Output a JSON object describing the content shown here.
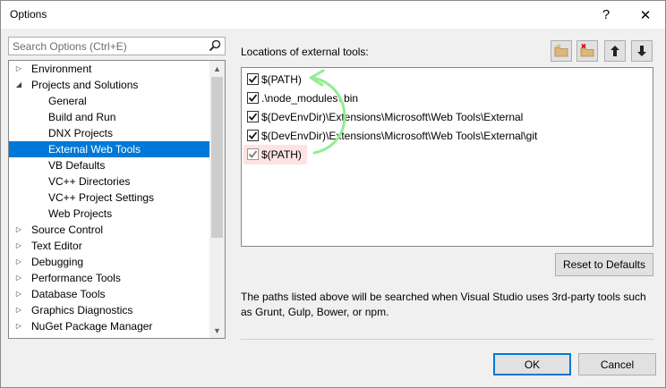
{
  "window": {
    "title": "Options",
    "help_glyph": "?",
    "close_glyph": "✕"
  },
  "search": {
    "placeholder": "Search Options (Ctrl+E)"
  },
  "tree": {
    "items": [
      {
        "label": "Environment",
        "level": 0,
        "arrow": "▷"
      },
      {
        "label": "Projects and Solutions",
        "level": 0,
        "arrow": "◢"
      },
      {
        "label": "General",
        "level": 1,
        "arrow": ""
      },
      {
        "label": "Build and Run",
        "level": 1,
        "arrow": ""
      },
      {
        "label": "DNX Projects",
        "level": 1,
        "arrow": ""
      },
      {
        "label": "External Web Tools",
        "level": 1,
        "arrow": "",
        "selected": true
      },
      {
        "label": "VB Defaults",
        "level": 1,
        "arrow": ""
      },
      {
        "label": "VC++ Directories",
        "level": 1,
        "arrow": ""
      },
      {
        "label": "VC++ Project Settings",
        "level": 1,
        "arrow": ""
      },
      {
        "label": "Web Projects",
        "level": 1,
        "arrow": ""
      },
      {
        "label": "Source Control",
        "level": 0,
        "arrow": "▷"
      },
      {
        "label": "Text Editor",
        "level": 0,
        "arrow": "▷"
      },
      {
        "label": "Debugging",
        "level": 0,
        "arrow": "▷"
      },
      {
        "label": "Performance Tools",
        "level": 0,
        "arrow": "▷"
      },
      {
        "label": "Database Tools",
        "level": 0,
        "arrow": "▷"
      },
      {
        "label": "Graphics Diagnostics",
        "level": 0,
        "arrow": "▷"
      },
      {
        "label": "NuGet Package Manager",
        "level": 0,
        "arrow": "▷"
      }
    ],
    "scroll_up_glyph": "▲",
    "scroll_down_glyph": "▼"
  },
  "locations": {
    "label": "Locations of external tools:",
    "toolbar": [
      {
        "name": "new-folder-icon",
        "kind": "add"
      },
      {
        "name": "delete-folder-icon",
        "kind": "delete"
      },
      {
        "name": "move-up-icon",
        "kind": "up"
      },
      {
        "name": "move-down-icon",
        "kind": "down"
      }
    ],
    "paths": [
      {
        "text": "$(PATH)",
        "checked": true,
        "highlighted": false
      },
      {
        "text": ".\\node_modules\\.bin",
        "checked": true,
        "highlighted": false
      },
      {
        "text": "$(DevEnvDir)\\Extensions\\Microsoft\\Web Tools\\External",
        "checked": true,
        "highlighted": false
      },
      {
        "text": "$(DevEnvDir)\\Extensions\\Microsoft\\Web Tools\\External\\git",
        "checked": true,
        "highlighted": false
      },
      {
        "text": "$(PATH)",
        "checked": true,
        "highlighted": true
      }
    ],
    "annotation_color": "#90ee90",
    "highlight_color": "#fde3e3"
  },
  "reset_label": "Reset to Defaults",
  "description": "The paths listed above will be searched when Visual Studio uses 3rd-party tools such as Grunt, Gulp, Bower, or npm.",
  "buttons": {
    "ok": "OK",
    "cancel": "Cancel"
  },
  "colors": {
    "selection": "#0078d7",
    "accent": "#0078d7"
  }
}
